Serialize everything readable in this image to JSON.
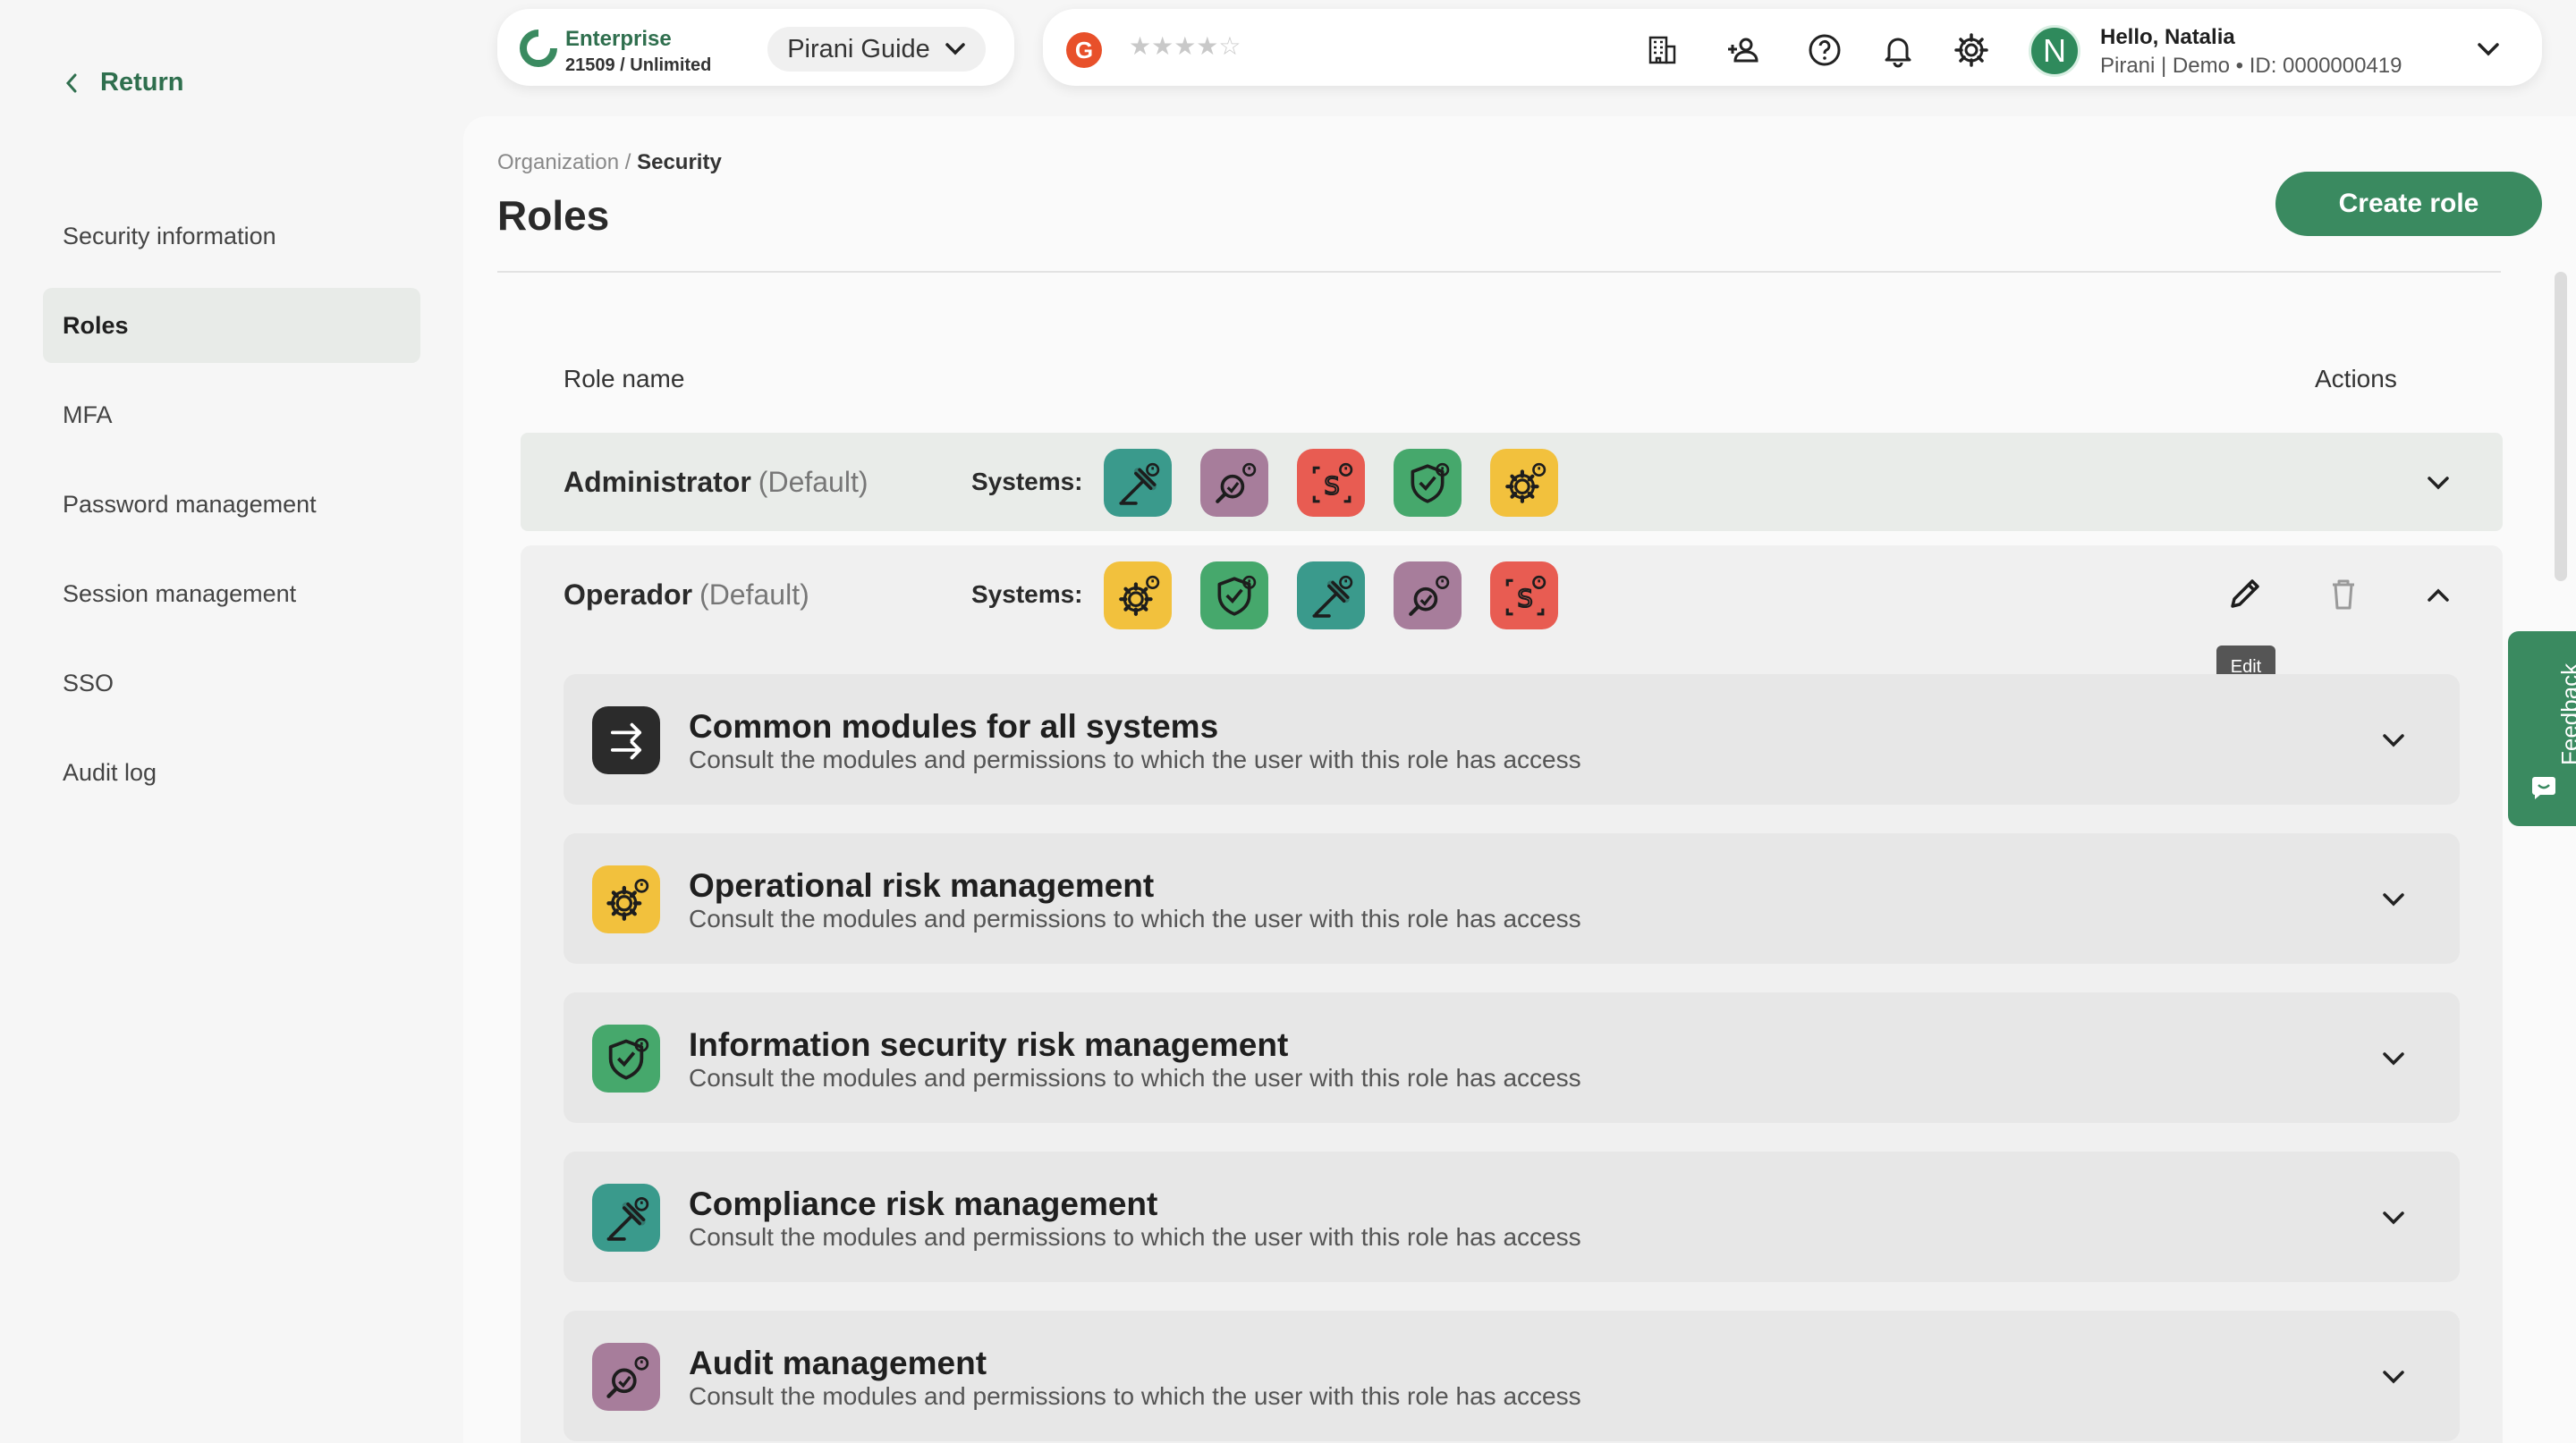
{
  "sidebar": {
    "return_label": "Return",
    "items": [
      {
        "label": "Security information",
        "active": false
      },
      {
        "label": "Roles",
        "active": true
      },
      {
        "label": "MFA",
        "active": false
      },
      {
        "label": "Password management",
        "active": false
      },
      {
        "label": "Session management",
        "active": false
      },
      {
        "label": "SSO",
        "active": false
      },
      {
        "label": "Audit log",
        "active": false
      }
    ]
  },
  "brand": {
    "plan": "Enterprise",
    "usage": "21509 / Unlimited",
    "guide_label": "Pirani Guide"
  },
  "topbar": {
    "rating_logo": "G",
    "stars": "★★★★☆",
    "icons": [
      "building-icon",
      "add-user-icon",
      "help-icon",
      "bell-icon",
      "gear-icon"
    ],
    "user": {
      "initial": "N",
      "greeting": "Hello, Natalia",
      "org": "Pirani | Demo • ID: 0000000419"
    }
  },
  "page": {
    "breadcrumb_parent": "Organization /",
    "breadcrumb_current": "Security",
    "title": "Roles",
    "create_button": "Create role"
  },
  "table": {
    "col_role_name": "Role name",
    "col_actions": "Actions",
    "systems_label": "Systems:",
    "roles": [
      {
        "name": "Administrator",
        "tag": "(Default)",
        "systems": [
          "compliance",
          "audit",
          "aml",
          "infosec",
          "operational"
        ],
        "expanded": false
      },
      {
        "name": "Operador",
        "tag": "(Default)",
        "systems": [
          "operational",
          "infosec",
          "compliance",
          "audit",
          "aml"
        ],
        "expanded": true
      }
    ],
    "edit_tooltip": "Edit"
  },
  "colors": {
    "compliance": "#3a9a8c",
    "audit": "#a77d9b",
    "aml": "#e85c52",
    "infosec": "#46a86c",
    "operational": "#f2c13d",
    "common": "#2b2b2b",
    "accent": "#3a8a60"
  },
  "modules": [
    {
      "title": "Common modules for all systems",
      "subtitle": "Consult the modules and permissions to which the user with this role has access",
      "system": "common"
    },
    {
      "title": "Operational risk management",
      "subtitle": "Consult the modules and permissions to which the user with this role has access",
      "system": "operational"
    },
    {
      "title": "Information security risk management",
      "subtitle": "Consult the modules and permissions to which the user with this role has access",
      "system": "infosec"
    },
    {
      "title": "Compliance risk management",
      "subtitle": "Consult the modules and permissions to which the user with this role has access",
      "system": "compliance"
    },
    {
      "title": "Audit management",
      "subtitle": "Consult the modules and permissions to which the user with this role has access",
      "system": "audit"
    }
  ],
  "feedback_label": "Feedback"
}
